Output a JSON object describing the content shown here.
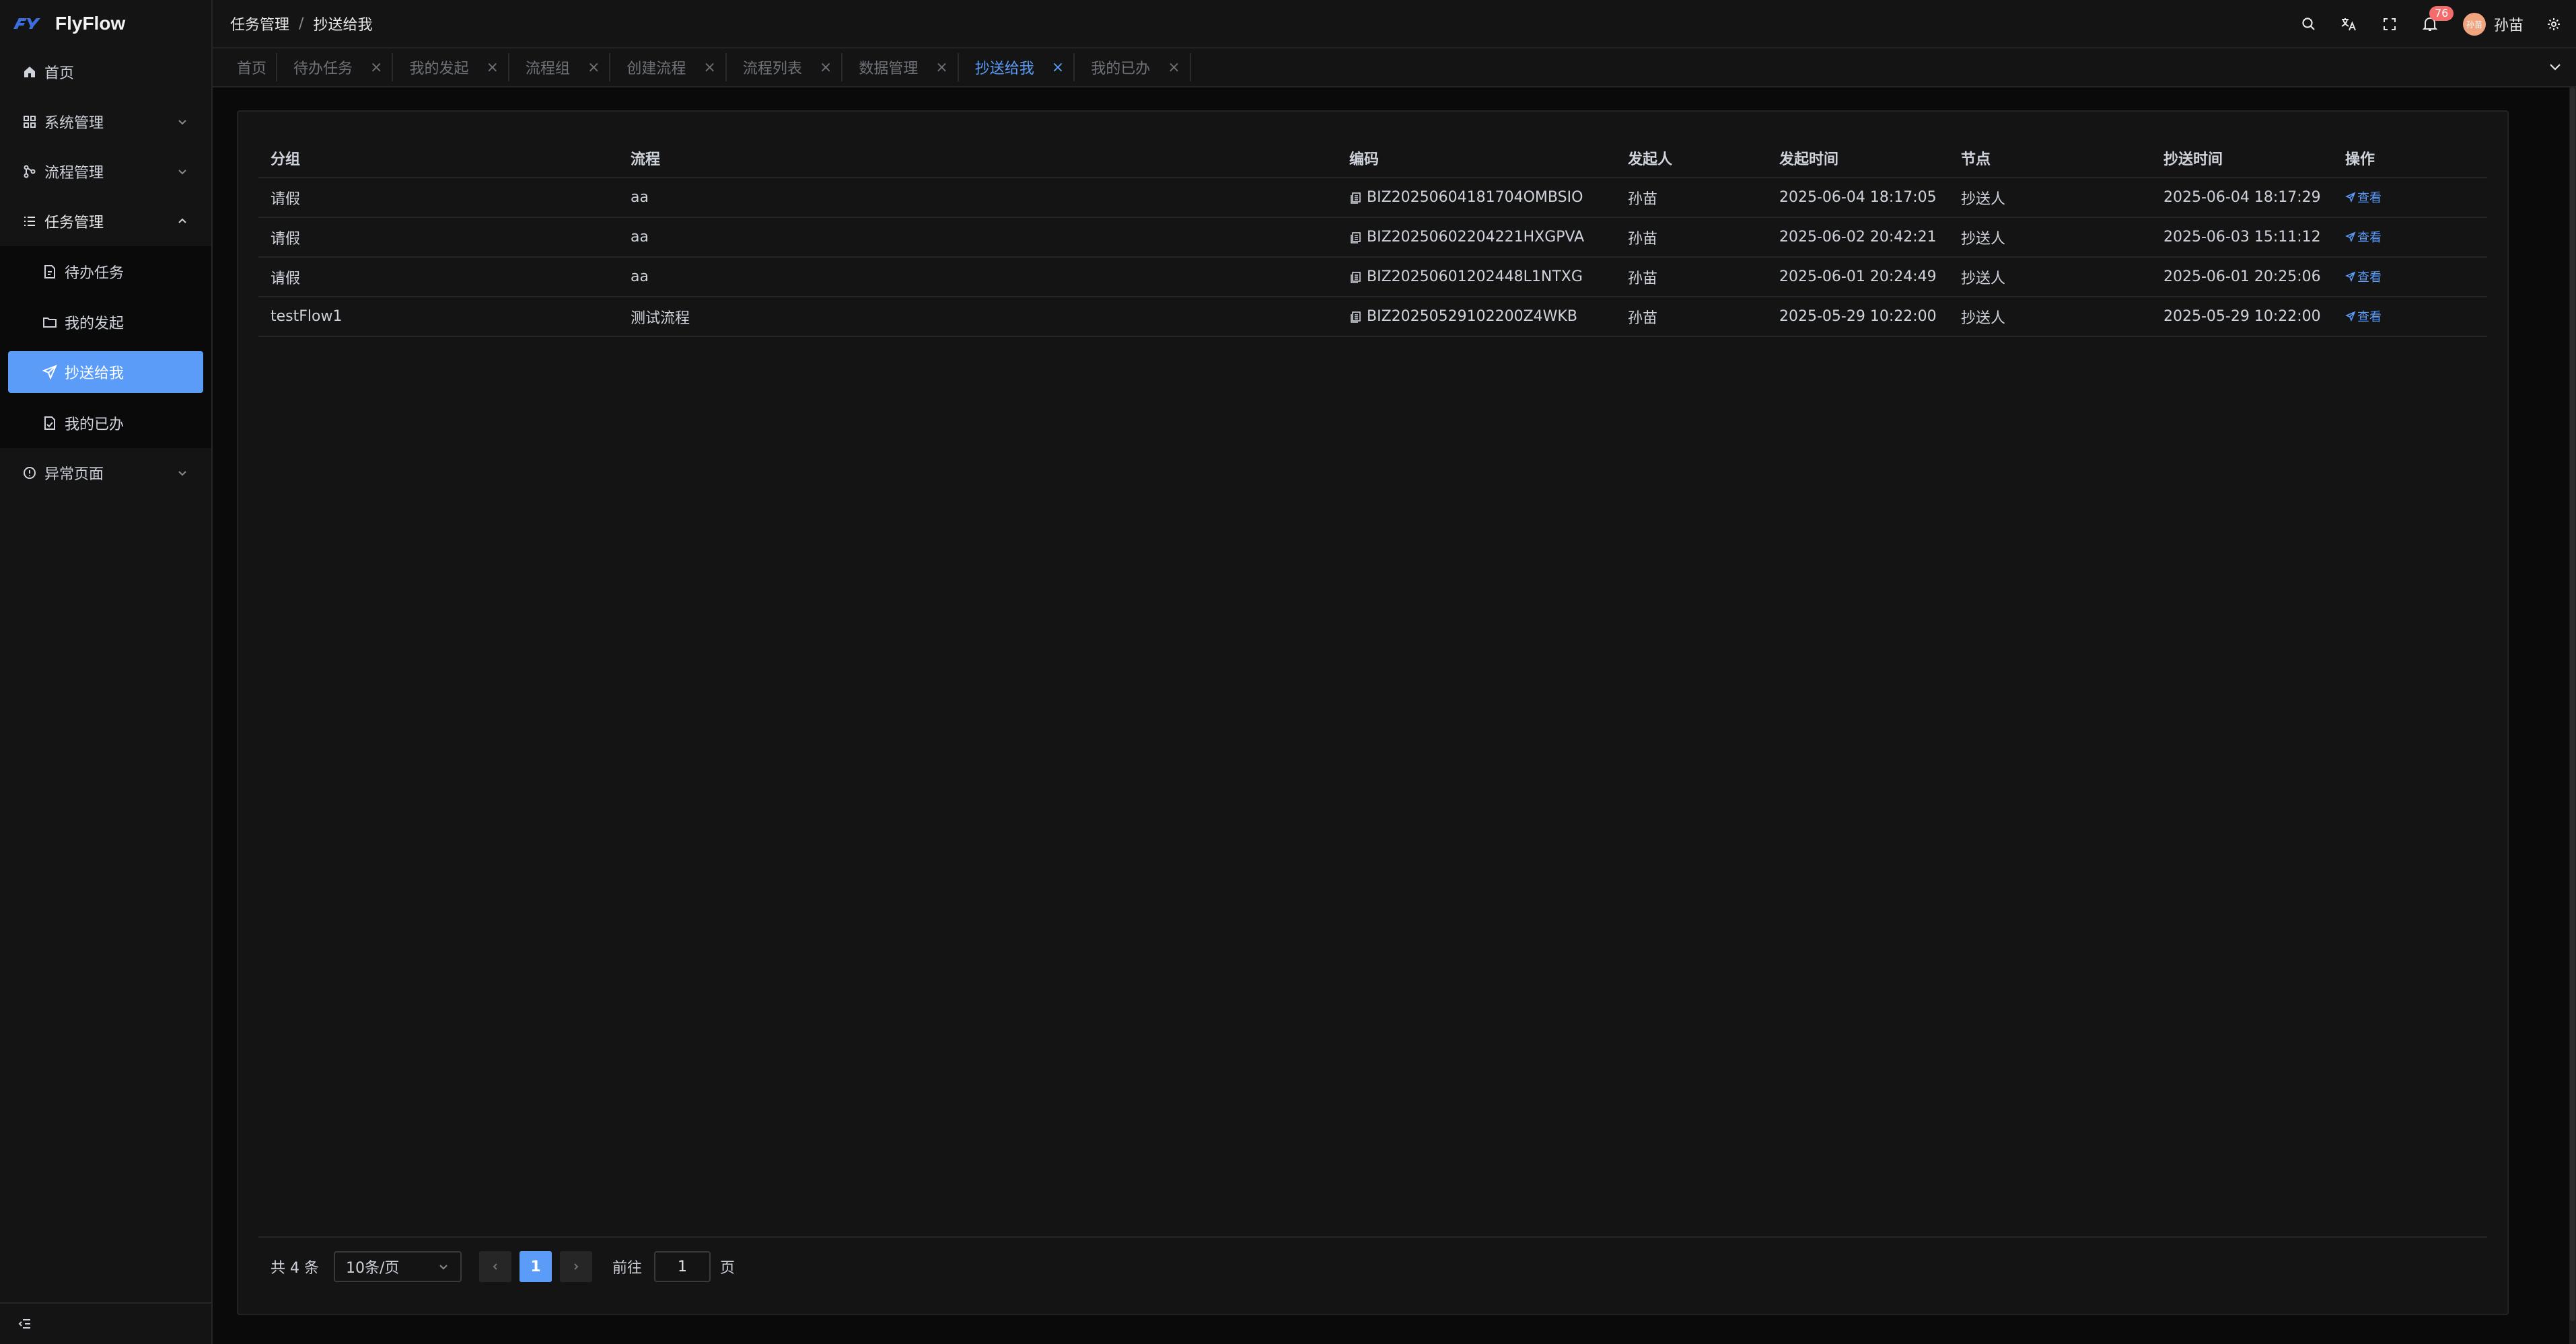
{
  "app": {
    "name": "FlyFlow"
  },
  "sidebar": {
    "items": [
      {
        "label": "首页",
        "icon": "home-icon"
      },
      {
        "label": "系统管理",
        "icon": "grid-icon"
      },
      {
        "label": "流程管理",
        "icon": "flow-icon"
      },
      {
        "label": "任务管理",
        "icon": "list-icon",
        "expanded": true
      },
      {
        "label": "异常页面",
        "icon": "info-icon"
      }
    ],
    "task_sub": [
      {
        "label": "待办任务",
        "icon": "doc-icon"
      },
      {
        "label": "我的发起",
        "icon": "folder-icon"
      },
      {
        "label": "抄送给我",
        "icon": "send-icon",
        "active": true
      },
      {
        "label": "我的已办",
        "icon": "doc-check-icon"
      }
    ]
  },
  "header": {
    "breadcrumb": [
      "任务管理",
      "抄送给我"
    ],
    "notification_count": "76",
    "avatar_text": "孙苗",
    "username": "孙苗"
  },
  "tabs": [
    "首页",
    "待办任务",
    "我的发起",
    "流程组",
    "创建流程",
    "流程列表",
    "数据管理",
    "抄送给我",
    "我的已办"
  ],
  "active_tab_index": 7,
  "table": {
    "columns": [
      "分组",
      "流程",
      "编码",
      "发起人",
      "发起时间",
      "节点",
      "抄送时间",
      "操作"
    ],
    "rows": [
      {
        "group": "请假",
        "flow": "aa",
        "code": "BIZ20250604181704OMBSIO",
        "initiator": "孙苗",
        "start_time": "2025-06-04 18:17:05",
        "node": "抄送人",
        "cc_time": "2025-06-04 18:17:29",
        "action": "查看"
      },
      {
        "group": "请假",
        "flow": "aa",
        "code": "BIZ20250602204221HXGPVA",
        "initiator": "孙苗",
        "start_time": "2025-06-02 20:42:21",
        "node": "抄送人",
        "cc_time": "2025-06-03 15:11:12",
        "action": "查看"
      },
      {
        "group": "请假",
        "flow": "aa",
        "code": "BIZ20250601202448L1NTXG",
        "initiator": "孙苗",
        "start_time": "2025-06-01 20:24:49",
        "node": "抄送人",
        "cc_time": "2025-06-01 20:25:06",
        "action": "查看"
      },
      {
        "group": "testFlow1",
        "flow": "测试流程",
        "code": "BIZ20250529102200Z4WKB",
        "initiator": "孙苗",
        "start_time": "2025-05-29 10:22:00",
        "node": "抄送人",
        "cc_time": "2025-05-29 10:22:00",
        "action": "查看"
      }
    ]
  },
  "pagination": {
    "total": "共 4 条",
    "page_size": "10条/页",
    "current_page": "1",
    "goto_label": "前往",
    "goto_value": "1",
    "page_suffix": "页"
  },
  "colors": {
    "accent": "#5a9cf8",
    "badge": "#f56c6c",
    "background": "#0a0a0a",
    "panel": "#141414"
  }
}
